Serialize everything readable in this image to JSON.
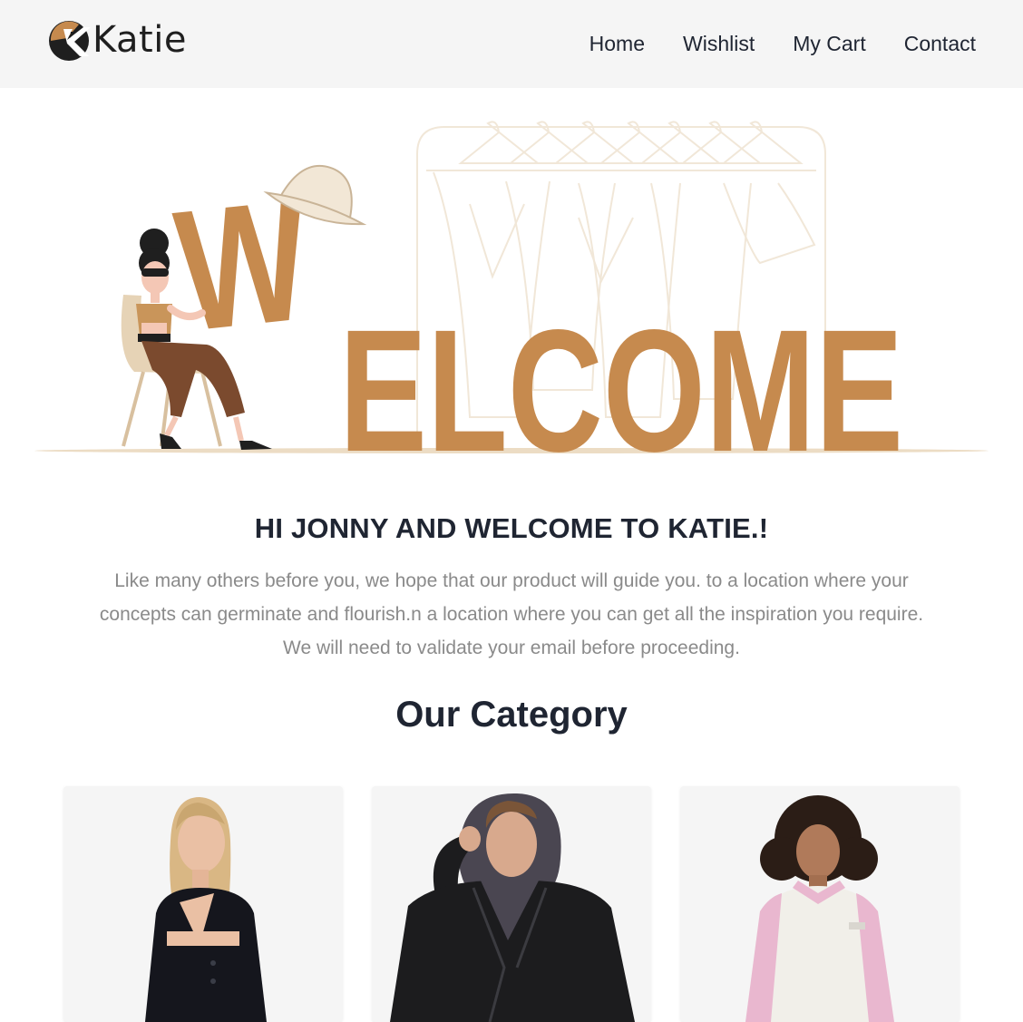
{
  "header": {
    "brand": "Katie",
    "nav": [
      {
        "label": "Home"
      },
      {
        "label": "Wishlist"
      },
      {
        "label": "My Cart"
      },
      {
        "label": "Contact"
      }
    ]
  },
  "hero": {
    "banner_text": "WELCOME"
  },
  "greeting": {
    "title": "HI JONNY AND WELCOME TO KATIE.!",
    "text": "Like many others before you, we hope that our product will guide you. to a location where your concepts can germinate and flourish.n a location where you can get all the inspiration you require. We will need to validate your email before proceeding."
  },
  "category": {
    "title": "Our Category",
    "items": [
      {
        "image": "woman-black-crop-jacket-photo"
      },
      {
        "image": "man-leather-jacket-hoodie-photo"
      },
      {
        "image": "woman-varsity-jacket-photo"
      }
    ]
  },
  "colors": {
    "accent": "#c68a4e",
    "header_bg": "#f5f5f5",
    "heading": "#1f2532",
    "body_text": "#8a8a8a"
  }
}
